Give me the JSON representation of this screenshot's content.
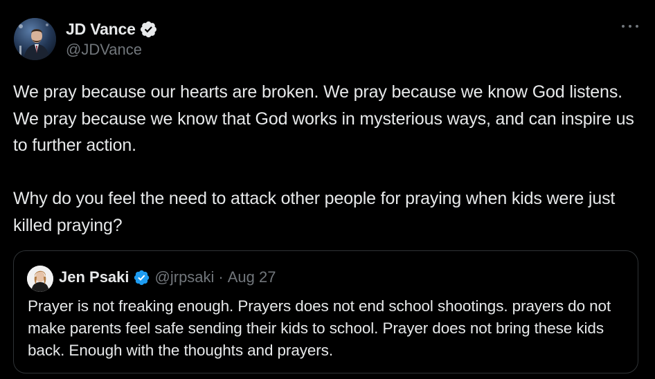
{
  "post": {
    "author": {
      "display_name": "JD Vance",
      "handle": "@JDVance",
      "verified": true
    },
    "text": "We pray because our hearts are broken. We pray because we know God listens. We pray because we know that God works in mysterious ways, and can inspire us to further action.\n\nWhy do you feel the need to attack other people for praying when kids were just killed praying?",
    "more_icon": "more-horizontal-icon"
  },
  "quoted_post": {
    "author": {
      "display_name": "Jen Psaki",
      "handle": "@jrpsaki",
      "verified": true
    },
    "separator": "·",
    "date": "Aug 27",
    "text": "Prayer is not freaking enough.  Prayers does not end school shootings. prayers do not make parents feel safe sending their kids to school.  Prayer does not bring these kids back. Enough with the thoughts and prayers."
  },
  "colors": {
    "background": "#000000",
    "text_primary": "#e7e9ea",
    "text_secondary": "#71767b",
    "verified_blue": "#1d9bf0",
    "border": "#2f3336"
  }
}
